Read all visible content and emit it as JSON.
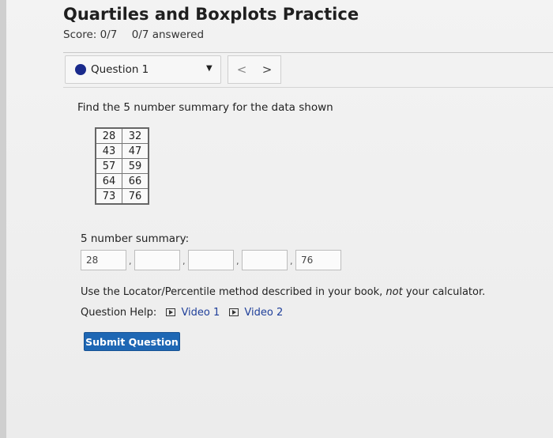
{
  "header": {
    "title": "Quartiles and Boxplots Practice",
    "score": "Score: 0/7",
    "answered": "0/7 answered"
  },
  "question_nav": {
    "selected": "Question 1",
    "prev_label": "<",
    "next_label": ">"
  },
  "question": {
    "prompt": "Find the 5 number summary for the data shown",
    "data_table": [
      [
        "28",
        "32"
      ],
      [
        "43",
        "47"
      ],
      [
        "57",
        "59"
      ],
      [
        "64",
        "66"
      ],
      [
        "73",
        "76"
      ]
    ],
    "summary_label": "5 number summary:",
    "inputs": {
      "min": "28",
      "q1": "",
      "median": "",
      "q3": "",
      "max": "76"
    },
    "separator": ",",
    "instructions": "Use the Locator/Percentile method described in your book, not your calculator.",
    "help_label": "Question Help:",
    "video1": "Video 1",
    "video2": "Video 2",
    "submit_label": "Submit Question"
  },
  "colors": {
    "accent": "#1e67b4",
    "question_dot": "#1a2a8c",
    "link": "#1f3f9a"
  }
}
